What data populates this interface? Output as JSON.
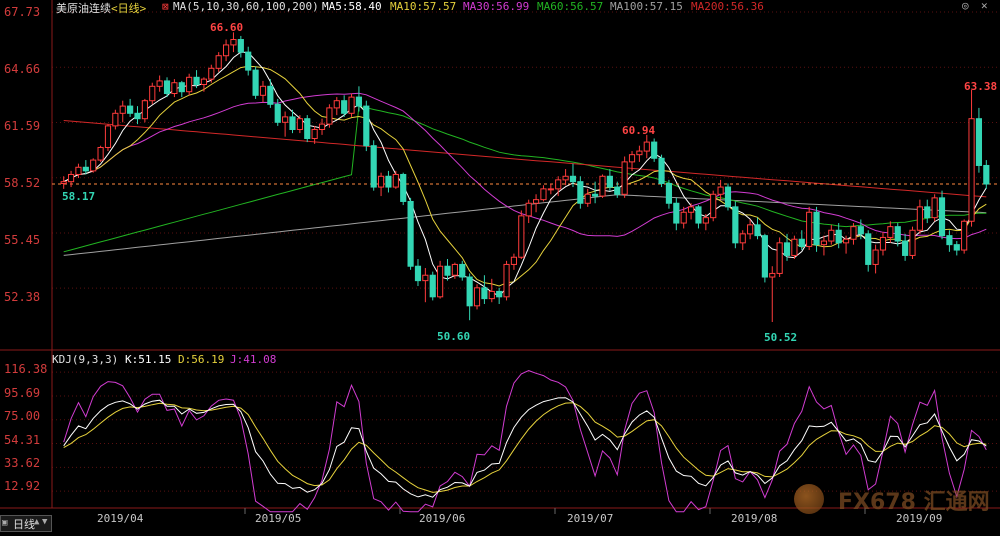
{
  "price_panel": {
    "header": {
      "instrument": "美原油连续",
      "period": "<日线>",
      "ma_params": "MA(5,10,30,60,100,200)",
      "ma5": "MA5:58.40",
      "ma10": "MA10:57.57",
      "ma30": "MA30:56.99",
      "ma60": "MA60:56.57",
      "ma100": "MA100:57.15",
      "ma200": "MA200:56.36"
    },
    "y_ticks": [
      "67.73",
      "64.66",
      "61.59",
      "58.52",
      "55.45",
      "52.38"
    ],
    "annotations": {
      "high1": "66.60",
      "low_start": "58.17",
      "low1": "50.60",
      "high2": "60.94",
      "low2": "50.52",
      "high3": "63.38"
    }
  },
  "kdj_panel": {
    "header": {
      "params": "KDJ(9,3,3)",
      "k": "K:51.15",
      "d": "D:56.19",
      "j": "J:41.08"
    },
    "y_ticks": [
      "116.38",
      "95.69",
      "75.00",
      "54.31",
      "33.62",
      "12.92"
    ]
  },
  "x_ticks": [
    "2019/04",
    "2019/05",
    "2019/06",
    "2019/07",
    "2019/08",
    "2019/09"
  ],
  "footer": {
    "period_button": "日线",
    "watermark": "FX678 汇通网"
  },
  "colors": {
    "up": "#ff3c3c",
    "down": "#33d6b4",
    "ma5": "#ffffff",
    "ma10": "#e6d23c",
    "ma30": "#d23cd2",
    "ma60": "#22b422",
    "ma100": "#a0a0a0",
    "ma200": "#d22828",
    "grid": "#5a1010",
    "last_price_line": "#ff8a40"
  },
  "chart_data": [
    {
      "type": "candlestick",
      "title": "美原油连续 <日线>",
      "ylim": [
        50.0,
        67.73
      ],
      "last_price": 58.17,
      "candles": [
        [
          58.2,
          58.6,
          57.9,
          58.3
        ],
        [
          58.3,
          58.9,
          58.0,
          58.7
        ],
        [
          58.7,
          59.3,
          58.5,
          59.1
        ],
        [
          59.1,
          59.5,
          58.7,
          58.9
        ],
        [
          58.9,
          59.6,
          58.8,
          59.5
        ],
        [
          59.5,
          60.3,
          59.4,
          60.2
        ],
        [
          60.2,
          61.5,
          60.0,
          61.4
        ],
        [
          61.4,
          62.3,
          61.2,
          62.1
        ],
        [
          62.1,
          62.8,
          61.6,
          62.5
        ],
        [
          62.5,
          62.9,
          61.9,
          62.1
        ],
        [
          62.1,
          62.5,
          61.5,
          61.8
        ],
        [
          61.8,
          62.9,
          61.6,
          62.8
        ],
        [
          62.8,
          63.8,
          62.6,
          63.6
        ],
        [
          63.6,
          64.2,
          63.3,
          63.9
        ],
        [
          63.9,
          64.1,
          63.0,
          63.2
        ],
        [
          63.2,
          64.0,
          63.0,
          63.8
        ],
        [
          63.8,
          63.9,
          63.0,
          63.3
        ],
        [
          63.3,
          64.3,
          63.1,
          64.1
        ],
        [
          64.1,
          64.5,
          63.5,
          63.7
        ],
        [
          63.7,
          64.1,
          63.3,
          64.0
        ],
        [
          64.0,
          64.8,
          63.8,
          64.6
        ],
        [
          64.6,
          65.5,
          64.4,
          65.3
        ],
        [
          65.3,
          66.2,
          65.0,
          65.9
        ],
        [
          65.9,
          66.6,
          65.5,
          66.2
        ],
        [
          66.2,
          66.4,
          65.2,
          65.5
        ],
        [
          65.5,
          65.8,
          64.2,
          64.5
        ],
        [
          64.5,
          64.7,
          62.9,
          63.1
        ],
        [
          63.1,
          63.9,
          62.7,
          63.6
        ],
        [
          63.6,
          64.0,
          62.4,
          62.6
        ],
        [
          62.6,
          62.9,
          61.4,
          61.6
        ],
        [
          61.6,
          62.2,
          60.8,
          61.9
        ],
        [
          61.9,
          62.3,
          61.0,
          61.2
        ],
        [
          61.2,
          62.0,
          61.0,
          61.8
        ],
        [
          61.8,
          62.0,
          60.5,
          60.7
        ],
        [
          60.7,
          61.4,
          60.4,
          61.2
        ],
        [
          61.2,
          61.8,
          60.9,
          61.5
        ],
        [
          61.5,
          62.6,
          61.3,
          62.4
        ],
        [
          62.4,
          63.0,
          62.0,
          62.8
        ],
        [
          62.8,
          63.1,
          61.9,
          62.1
        ],
        [
          62.1,
          63.2,
          61.9,
          63.0
        ],
        [
          63.0,
          63.6,
          62.2,
          62.5
        ],
        [
          62.5,
          62.8,
          60.0,
          60.3
        ],
        [
          60.3,
          60.6,
          57.8,
          58.0
        ],
        [
          58.0,
          58.8,
          57.5,
          58.6
        ],
        [
          58.6,
          58.9,
          57.7,
          58.0
        ],
        [
          58.0,
          58.9,
          57.9,
          58.7
        ],
        [
          58.7,
          58.8,
          57.0,
          57.2
        ],
        [
          57.2,
          57.4,
          53.4,
          53.6
        ],
        [
          53.6,
          54.0,
          52.5,
          52.8
        ],
        [
          52.8,
          53.5,
          51.6,
          53.1
        ],
        [
          53.1,
          53.3,
          51.7,
          51.9
        ],
        [
          51.9,
          53.9,
          51.8,
          53.6
        ],
        [
          53.6,
          54.0,
          52.8,
          53.1
        ],
        [
          53.1,
          53.8,
          52.9,
          53.7
        ],
        [
          53.7,
          53.9,
          52.8,
          53.0
        ],
        [
          53.0,
          53.2,
          50.6,
          51.4
        ],
        [
          51.4,
          52.6,
          51.2,
          52.4
        ],
        [
          52.4,
          53.1,
          51.5,
          51.8
        ],
        [
          51.8,
          52.9,
          51.6,
          52.2
        ],
        [
          52.2,
          52.4,
          51.5,
          51.9
        ],
        [
          51.9,
          53.9,
          51.7,
          53.7
        ],
        [
          53.7,
          54.3,
          53.4,
          54.1
        ],
        [
          54.1,
          56.7,
          54.0,
          56.4
        ],
        [
          56.4,
          57.3,
          56.0,
          57.1
        ],
        [
          57.1,
          57.6,
          56.6,
          57.3
        ],
        [
          57.3,
          58.1,
          57.2,
          57.9
        ],
        [
          57.9,
          58.2,
          57.6,
          57.9
        ],
        [
          57.9,
          58.6,
          57.5,
          58.4
        ],
        [
          58.4,
          59.0,
          58.1,
          58.6
        ],
        [
          58.6,
          59.3,
          58.0,
          58.3
        ],
        [
          58.3,
          58.6,
          56.8,
          57.1
        ],
        [
          57.1,
          57.9,
          56.9,
          57.6
        ],
        [
          57.6,
          58.3,
          57.1,
          57.5
        ],
        [
          57.5,
          58.7,
          57.4,
          58.6
        ],
        [
          58.6,
          59.0,
          57.8,
          58.0
        ],
        [
          58.0,
          58.3,
          57.4,
          57.6
        ],
        [
          57.6,
          59.7,
          57.4,
          59.4
        ],
        [
          59.4,
          60.0,
          58.9,
          59.8
        ],
        [
          59.8,
          60.3,
          59.4,
          60.0
        ],
        [
          60.0,
          60.9,
          59.6,
          60.5
        ],
        [
          60.5,
          60.7,
          59.4,
          59.6
        ],
        [
          59.6,
          59.8,
          58.0,
          58.2
        ],
        [
          58.2,
          58.4,
          56.8,
          57.1
        ],
        [
          57.1,
          57.4,
          55.6,
          56.0
        ],
        [
          56.0,
          56.9,
          55.7,
          56.6
        ],
        [
          56.6,
          57.1,
          56.2,
          56.9
        ],
        [
          56.9,
          57.0,
          55.7,
          56.0
        ],
        [
          56.0,
          56.5,
          55.6,
          56.3
        ],
        [
          56.3,
          57.8,
          56.1,
          57.6
        ],
        [
          57.6,
          58.4,
          57.3,
          58.0
        ],
        [
          58.0,
          58.2,
          56.7,
          56.9
        ],
        [
          56.9,
          57.2,
          54.6,
          54.9
        ],
        [
          54.9,
          55.6,
          54.5,
          55.4
        ],
        [
          55.4,
          56.2,
          55.1,
          55.9
        ],
        [
          55.9,
          56.3,
          55.1,
          55.3
        ],
        [
          55.3,
          55.4,
          52.7,
          53.0
        ],
        [
          53.0,
          53.6,
          50.5,
          53.2
        ],
        [
          53.2,
          55.2,
          53.0,
          54.9
        ],
        [
          54.9,
          55.4,
          53.9,
          54.2
        ],
        [
          54.2,
          55.3,
          54.0,
          55.1
        ],
        [
          55.1,
          55.6,
          54.5,
          54.7
        ],
        [
          54.7,
          56.9,
          54.5,
          56.6
        ],
        [
          56.6,
          56.9,
          54.4,
          54.8
        ],
        [
          54.8,
          55.3,
          54.2,
          55.0
        ],
        [
          55.0,
          55.9,
          54.8,
          55.6
        ],
        [
          55.6,
          56.0,
          54.6,
          54.9
        ],
        [
          54.9,
          55.3,
          54.3,
          55.1
        ],
        [
          55.1,
          56.0,
          54.8,
          55.8
        ],
        [
          55.8,
          56.2,
          55.1,
          55.4
        ],
        [
          55.4,
          55.6,
          53.3,
          53.7
        ],
        [
          53.7,
          54.8,
          53.2,
          54.5
        ],
        [
          54.5,
          55.5,
          54.2,
          55.2
        ],
        [
          55.2,
          56.1,
          54.9,
          55.8
        ],
        [
          55.8,
          56.0,
          54.7,
          55.0
        ],
        [
          55.0,
          55.4,
          53.9,
          54.2
        ],
        [
          54.2,
          55.8,
          54.0,
          55.6
        ],
        [
          55.6,
          57.3,
          55.4,
          56.9
        ],
        [
          56.9,
          57.3,
          56.0,
          56.3
        ],
        [
          56.3,
          57.6,
          56.1,
          57.4
        ],
        [
          57.4,
          57.8,
          55.1,
          55.3
        ],
        [
          55.3,
          55.6,
          54.4,
          54.8
        ],
        [
          54.8,
          55.0,
          54.2,
          54.5
        ],
        [
          54.5,
          56.2,
          54.3,
          56.1
        ],
        [
          56.1,
          63.4,
          55.8,
          61.8
        ],
        [
          61.8,
          62.4,
          58.8,
          59.2
        ],
        [
          59.2,
          59.5,
          57.9,
          58.17
        ]
      ],
      "ma_series": [
        {
          "name": "MA5",
          "last": 58.4
        },
        {
          "name": "MA10",
          "last": 57.57
        },
        {
          "name": "MA30",
          "last": 56.99
        },
        {
          "name": "MA60",
          "last": 56.57
        },
        {
          "name": "MA100",
          "last": 57.15
        },
        {
          "name": "MA200",
          "last": 56.36
        }
      ],
      "markers": [
        {
          "label": "66.60",
          "type": "high"
        },
        {
          "label": "58.17",
          "type": "low"
        },
        {
          "label": "50.60",
          "type": "low"
        },
        {
          "label": "60.94",
          "type": "high"
        },
        {
          "label": "50.52",
          "type": "low"
        },
        {
          "label": "63.38",
          "type": "high"
        }
      ],
      "x_tick_labels": [
        "2019/04",
        "2019/05",
        "2019/06",
        "2019/07",
        "2019/08",
        "2019/09"
      ]
    },
    {
      "type": "line",
      "title": "KDJ(9,3,3)",
      "ylim": [
        0,
        120
      ],
      "series": [
        {
          "name": "K",
          "last": 51.15
        },
        {
          "name": "D",
          "last": 56.19
        },
        {
          "name": "J",
          "last": 41.08
        }
      ]
    }
  ]
}
